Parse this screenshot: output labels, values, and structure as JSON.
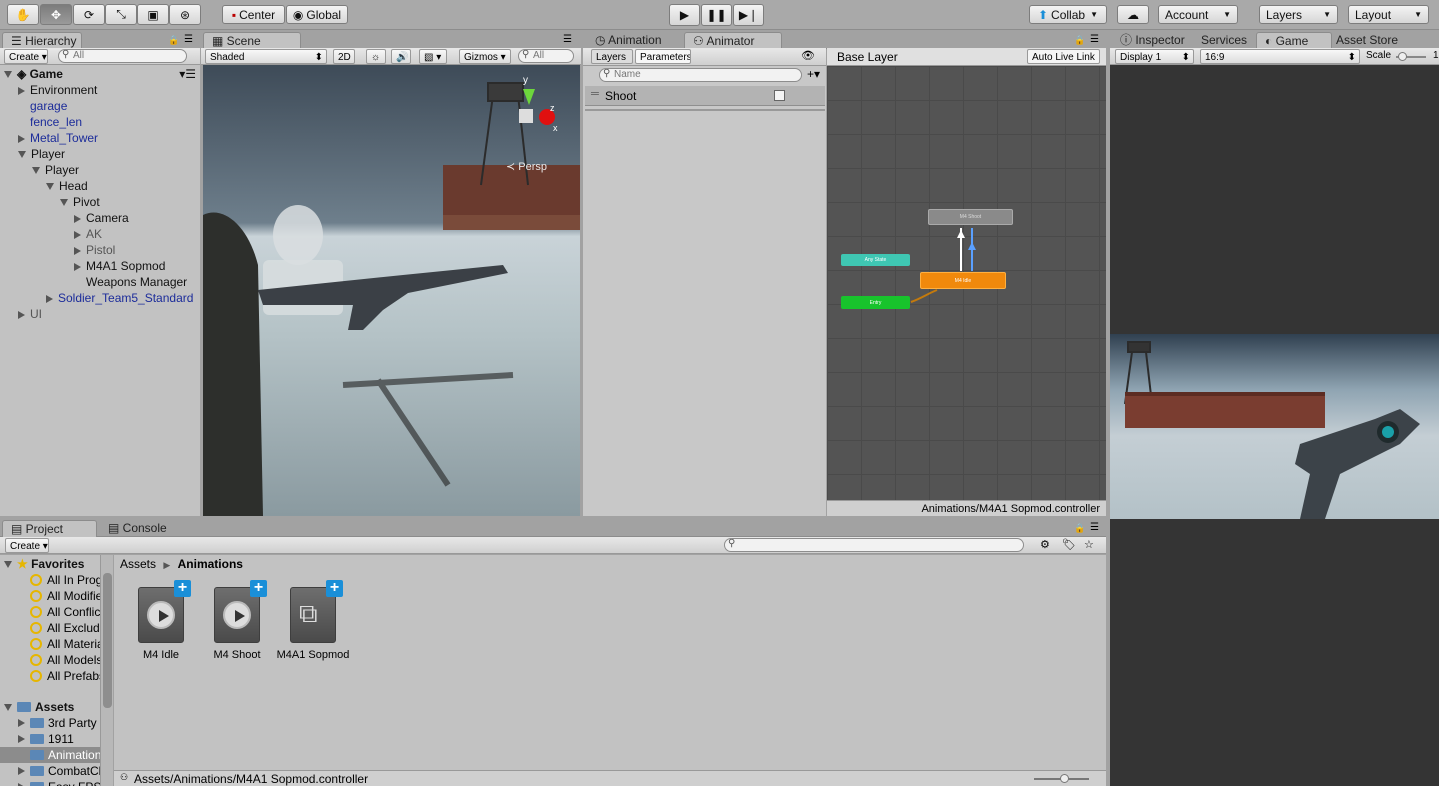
{
  "toolbar": {
    "tools": [
      "hand-tool",
      "move-tool",
      "rotate-tool",
      "scale-tool",
      "rect-tool",
      "transform-tool"
    ],
    "pivot": "Center",
    "space": "Global",
    "collab": "Collab",
    "account": "Account",
    "layers": "Layers",
    "layout": "Layout"
  },
  "hierarchy": {
    "tab": "Hierarchy",
    "create": "Create",
    "search_placeholder": "All",
    "scene": "Game",
    "items": [
      {
        "label": "Environment",
        "indent": 1,
        "arrow": "r",
        "style": ""
      },
      {
        "label": "garage",
        "indent": 1,
        "arrow": "",
        "style": "blue"
      },
      {
        "label": "fence_len",
        "indent": 1,
        "arrow": "",
        "style": "blue"
      },
      {
        "label": "Metal_Tower",
        "indent": 1,
        "arrow": "r",
        "style": "blue"
      },
      {
        "label": "Player",
        "indent": 1,
        "arrow": "d",
        "style": ""
      },
      {
        "label": "Player",
        "indent": 2,
        "arrow": "d",
        "style": ""
      },
      {
        "label": "Head",
        "indent": 3,
        "arrow": "d",
        "style": ""
      },
      {
        "label": "Pivot",
        "indent": 4,
        "arrow": "d",
        "style": ""
      },
      {
        "label": "Camera",
        "indent": 5,
        "arrow": "r",
        "style": ""
      },
      {
        "label": "AK",
        "indent": 5,
        "arrow": "r",
        "style": "gray"
      },
      {
        "label": "Pistol",
        "indent": 5,
        "arrow": "r",
        "style": "gray"
      },
      {
        "label": "M4A1 Sopmod",
        "indent": 5,
        "arrow": "r",
        "style": ""
      },
      {
        "label": "Weapons Manager",
        "indent": 5,
        "arrow": "",
        "style": ""
      },
      {
        "label": "Soldier_Team5_Standard",
        "indent": 3,
        "arrow": "r",
        "style": "blue"
      },
      {
        "label": "UI",
        "indent": 1,
        "arrow": "r",
        "style": "gray"
      }
    ]
  },
  "scene": {
    "tab": "Scene",
    "shading": "Shaded",
    "mode2d": "2D",
    "gizmos": "Gizmos",
    "search_placeholder": "All",
    "persp": "Persp",
    "axis_y": "y",
    "axis_z": "z",
    "axis_x": "x"
  },
  "animation_tab": "Animation",
  "animator": {
    "tab": "Animator",
    "layers_tab": "Layers",
    "parameters_tab": "Parameters",
    "search_placeholder": "Name",
    "param_name": "Shoot",
    "base_layer": "Base Layer",
    "auto_live_link": "Auto Live Link",
    "path": "Animations/M4A1 Sopmod.controller",
    "states": {
      "shoot": "M4 Shoot",
      "idle": "M4 Idle",
      "any": "Any State",
      "entry": "Entry"
    }
  },
  "inspector": {
    "tab": "Inspector",
    "services": "Services",
    "game": "Game",
    "asset_store": "Asset Store",
    "display": "Display 1",
    "aspect": "16:9",
    "scale_label": "Scale",
    "scale_value": "1"
  },
  "project": {
    "tab": "Project",
    "console": "Console",
    "create": "Create",
    "breadcrumb_root": "Assets",
    "breadcrumb_current": "Animations",
    "status_path": "Assets/Animations/M4A1 Sopmod.controller",
    "favorites_label": "Favorites",
    "favorites": [
      "All In Progress",
      "All Modified",
      "All Conflicts",
      "All Excluded",
      "All Materials",
      "All Models",
      "All Prefabs"
    ],
    "assets_label": "Assets",
    "folders": [
      "3rd Party",
      "1911",
      "Animations",
      "CombatCl",
      "Easy FPS"
    ],
    "files": [
      {
        "name": "M4 Idle",
        "kind": "anim"
      },
      {
        "name": "M4 Shoot",
        "kind": "anim"
      },
      {
        "name": "M4A1 Sopmod",
        "kind": "controller"
      }
    ]
  }
}
